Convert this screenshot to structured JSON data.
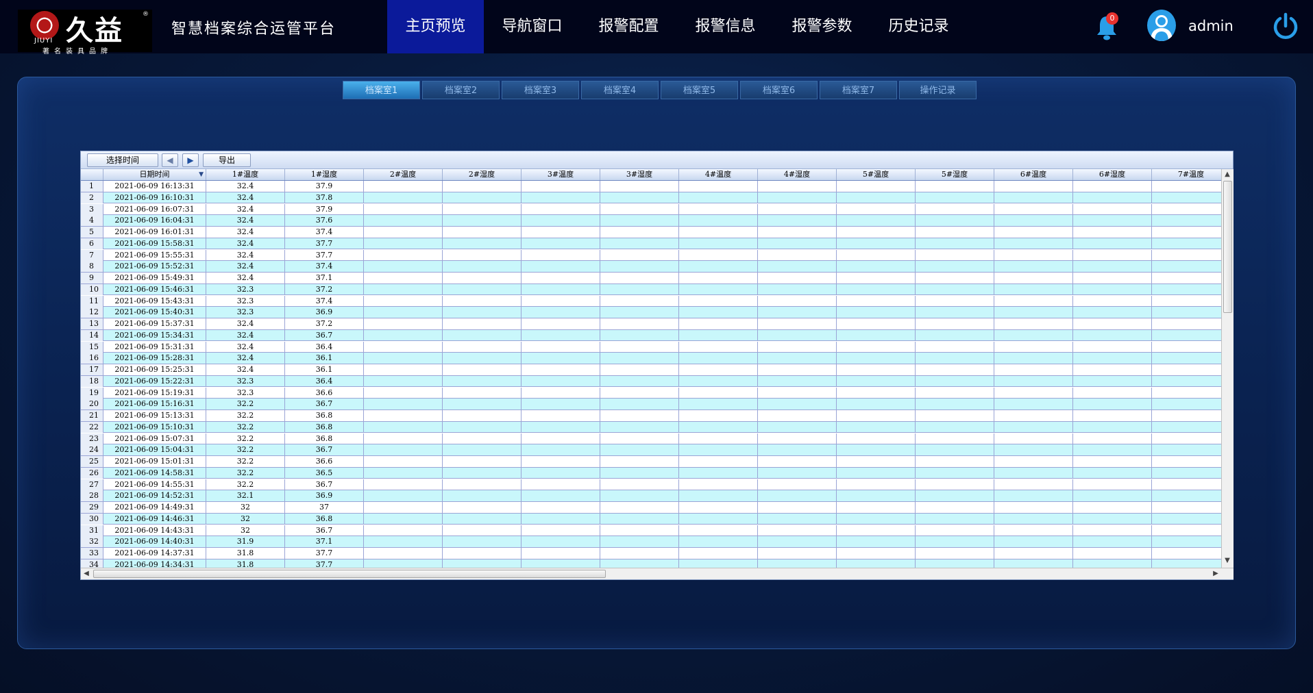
{
  "header": {
    "logo_main": "久益",
    "logo_en": "JIUYI",
    "logo_reg": "®",
    "logo_slogan": "著名装具品牌",
    "app_title": "智慧档案综合运管平台",
    "nav": [
      "主页预览",
      "导航窗口",
      "报警配置",
      "报警信息",
      "报警参数",
      "历史记录"
    ],
    "active_nav": 0,
    "notification_count": "0",
    "username": "admin",
    "icons": {
      "bell": "bell-icon",
      "avatar": "user-avatar-icon",
      "power": "power-icon"
    },
    "colors": {
      "accent": "#0b1a9a",
      "icon_blue": "#2a9ee8",
      "badge": "#e8322f"
    }
  },
  "room_tabs": {
    "items": [
      "档案室1",
      "档案室2",
      "档案室3",
      "档案室4",
      "档案室5",
      "档案室6",
      "档案室7",
      "操作记录"
    ],
    "active": 0
  },
  "toolbar": {
    "select_time": "选择时间",
    "prev_icon": "◀",
    "next_icon": "▶",
    "export": "导出"
  },
  "table": {
    "columns": [
      "日期时间",
      "1#温度",
      "1#湿度",
      "2#温度",
      "2#湿度",
      "3#温度",
      "3#湿度",
      "4#温度",
      "4#湿度",
      "5#温度",
      "5#湿度",
      "6#温度",
      "6#湿度",
      "7#温度"
    ],
    "sort_icon": "sort-down-icon",
    "rows": [
      [
        "1",
        "2021-06-09 16:13:31",
        "32.4",
        "37.9"
      ],
      [
        "2",
        "2021-06-09 16:10:31",
        "32.4",
        "37.8"
      ],
      [
        "3",
        "2021-06-09 16:07:31",
        "32.4",
        "37.9"
      ],
      [
        "4",
        "2021-06-09 16:04:31",
        "32.4",
        "37.6"
      ],
      [
        "5",
        "2021-06-09 16:01:31",
        "32.4",
        "37.4"
      ],
      [
        "6",
        "2021-06-09 15:58:31",
        "32.4",
        "37.7"
      ],
      [
        "7",
        "2021-06-09 15:55:31",
        "32.4",
        "37.7"
      ],
      [
        "8",
        "2021-06-09 15:52:31",
        "32.4",
        "37.4"
      ],
      [
        "9",
        "2021-06-09 15:49:31",
        "32.4",
        "37.1"
      ],
      [
        "10",
        "2021-06-09 15:46:31",
        "32.3",
        "37.2"
      ],
      [
        "11",
        "2021-06-09 15:43:31",
        "32.3",
        "37.4"
      ],
      [
        "12",
        "2021-06-09 15:40:31",
        "32.3",
        "36.9"
      ],
      [
        "13",
        "2021-06-09 15:37:31",
        "32.4",
        "37.2"
      ],
      [
        "14",
        "2021-06-09 15:34:31",
        "32.4",
        "36.7"
      ],
      [
        "15",
        "2021-06-09 15:31:31",
        "32.4",
        "36.4"
      ],
      [
        "16",
        "2021-06-09 15:28:31",
        "32.4",
        "36.1"
      ],
      [
        "17",
        "2021-06-09 15:25:31",
        "32.4",
        "36.1"
      ],
      [
        "18",
        "2021-06-09 15:22:31",
        "32.3",
        "36.4"
      ],
      [
        "19",
        "2021-06-09 15:19:31",
        "32.3",
        "36.6"
      ],
      [
        "20",
        "2021-06-09 15:16:31",
        "32.2",
        "36.7"
      ],
      [
        "21",
        "2021-06-09 15:13:31",
        "32.2",
        "36.8"
      ],
      [
        "22",
        "2021-06-09 15:10:31",
        "32.2",
        "36.8"
      ],
      [
        "23",
        "2021-06-09 15:07:31",
        "32.2",
        "36.8"
      ],
      [
        "24",
        "2021-06-09 15:04:31",
        "32.2",
        "36.7"
      ],
      [
        "25",
        "2021-06-09 15:01:31",
        "32.2",
        "36.6"
      ],
      [
        "26",
        "2021-06-09 14:58:31",
        "32.2",
        "36.5"
      ],
      [
        "27",
        "2021-06-09 14:55:31",
        "32.2",
        "36.7"
      ],
      [
        "28",
        "2021-06-09 14:52:31",
        "32.1",
        "36.9"
      ],
      [
        "29",
        "2021-06-09 14:49:31",
        "32",
        "37"
      ],
      [
        "30",
        "2021-06-09 14:46:31",
        "32",
        "36.8"
      ],
      [
        "31",
        "2021-06-09 14:43:31",
        "32",
        "36.7"
      ],
      [
        "32",
        "2021-06-09 14:40:31",
        "31.9",
        "37.1"
      ],
      [
        "33",
        "2021-06-09 14:37:31",
        "31.8",
        "37.7"
      ],
      [
        "34",
        "2021-06-09 14:34:31",
        "31.8",
        "37.7"
      ]
    ],
    "row_colors": {
      "odd": "#ffffff",
      "even": "#c9f7fb"
    }
  }
}
